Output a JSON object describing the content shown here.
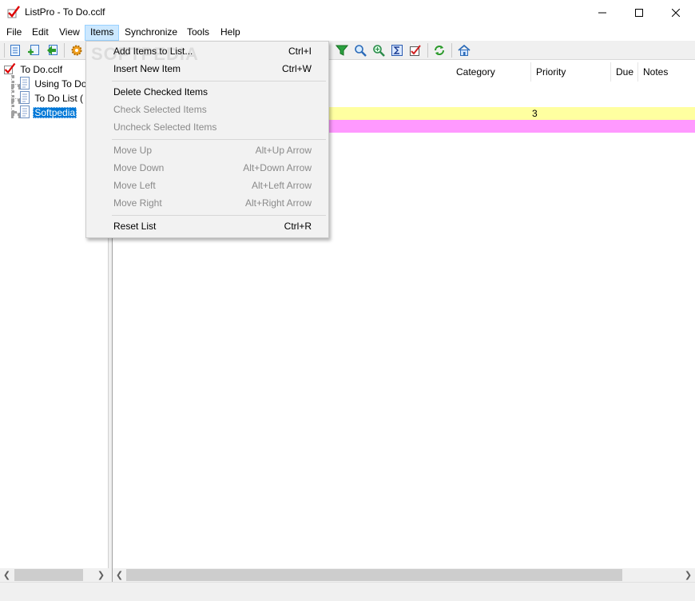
{
  "window": {
    "title": "ListPro - To Do.cclf"
  },
  "menubar": {
    "items": [
      "File",
      "Edit",
      "View",
      "Items",
      "Synchronize",
      "Tools",
      "Help"
    ],
    "active": "Items"
  },
  "tree": {
    "root": "To Do.cclf",
    "children": [
      "Using To Do",
      "To Do List (",
      "Softpedia"
    ],
    "selected": "Softpedia"
  },
  "list": {
    "columns": [
      "Category",
      "Priority",
      "Due",
      "Notes"
    ],
    "rows": [
      {
        "priority": "3",
        "color": "#ffffa0"
      },
      {
        "priority": "",
        "color": "#ff99ff"
      }
    ]
  },
  "items_menu": {
    "groups": [
      [
        {
          "label": "Add Items to List...",
          "shortcut": "Ctrl+I",
          "enabled": true
        },
        {
          "label": "Insert New Item",
          "shortcut": "Ctrl+W",
          "enabled": true
        }
      ],
      [
        {
          "label": "Delete Checked Items",
          "shortcut": "",
          "enabled": true
        },
        {
          "label": "Check Selected Items",
          "shortcut": "",
          "enabled": false
        },
        {
          "label": "Uncheck Selected Items",
          "shortcut": "",
          "enabled": false
        }
      ],
      [
        {
          "label": "Move Up",
          "shortcut": "Alt+Up Arrow",
          "enabled": false
        },
        {
          "label": "Move Down",
          "shortcut": "Alt+Down Arrow",
          "enabled": false
        },
        {
          "label": "Move Left",
          "shortcut": "Alt+Left Arrow",
          "enabled": false
        },
        {
          "label": "Move Right",
          "shortcut": "Alt+Right Arrow",
          "enabled": false
        }
      ],
      [
        {
          "label": "Reset List",
          "shortcut": "Ctrl+R",
          "enabled": true
        }
      ]
    ]
  },
  "watermark": "SOFTPEDIA",
  "colors": {
    "selection": "#0078d7",
    "menu_active": "#cce8ff",
    "row_yellow": "#ffffa0",
    "row_pink": "#ff99ff"
  },
  "icons": {
    "toolbar_left": [
      "new-list-icon",
      "add-list-icon",
      "import-icon",
      "settings-gear-icon"
    ],
    "toolbar_right": [
      "filter-icon",
      "search-icon",
      "zoom-icon",
      "sum-icon",
      "check-edit-icon",
      "refresh-icon",
      "home-icon"
    ]
  }
}
